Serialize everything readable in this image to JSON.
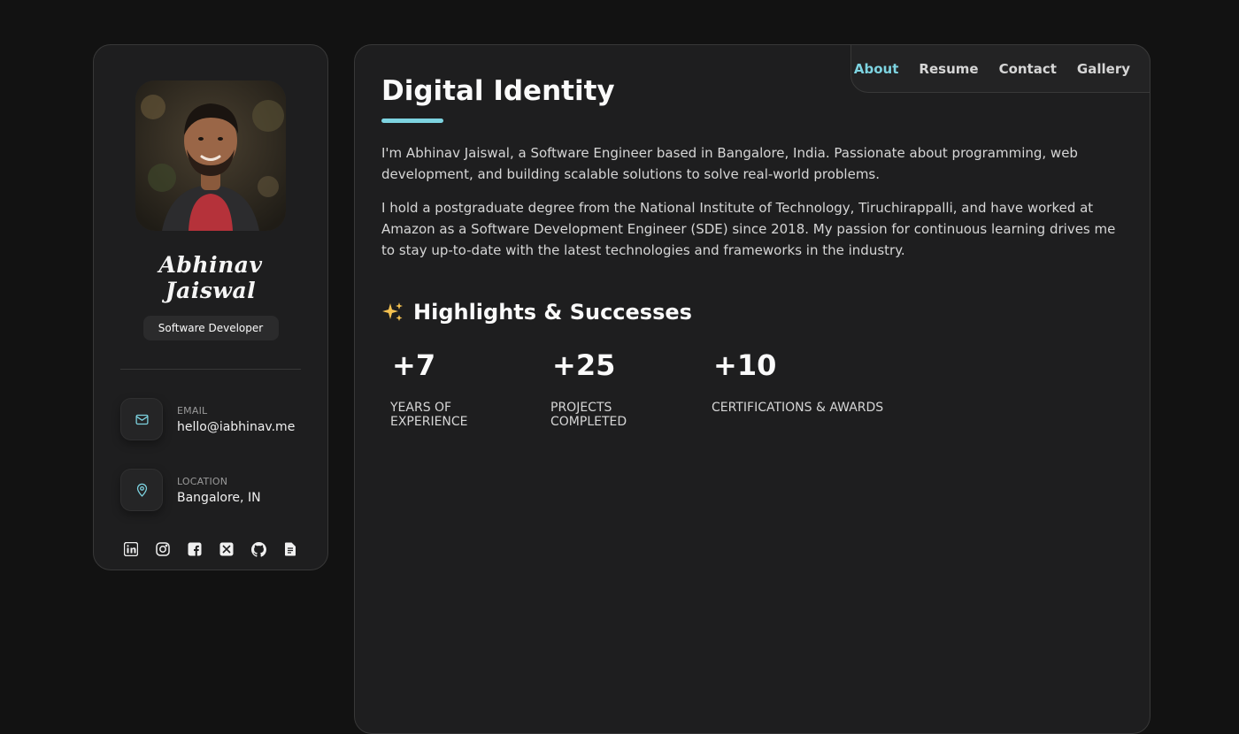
{
  "profile": {
    "name": "Abhinav Jaiswal",
    "role": "Software Developer",
    "avatar_alt": "Profile photo"
  },
  "contacts": [
    {
      "label": "EMAIL",
      "value": "hello@iabhinav.me",
      "icon": "mail-icon"
    },
    {
      "label": "LOCATION",
      "value": "Bangalore, IN",
      "icon": "map-pin-icon"
    }
  ],
  "socials": [
    {
      "name": "linkedin-icon"
    },
    {
      "name": "instagram-icon"
    },
    {
      "name": "facebook-icon"
    },
    {
      "name": "x-twitter-icon"
    },
    {
      "name": "github-icon"
    },
    {
      "name": "document-icon"
    }
  ],
  "nav": {
    "items": [
      "About",
      "Resume",
      "Contact",
      "Gallery"
    ],
    "active": "About"
  },
  "main": {
    "title": "Digital Identity",
    "paragraphs": [
      "I'm Abhinav Jaiswal, a Software Engineer based in Bangalore, India. Passionate about programming, web development, and building scalable solutions to solve real-world problems.",
      "I hold a postgraduate degree from the National Institute of Technology, Tiruchirappalli, and have worked at Amazon as a Software Development Engineer (SDE) since 2018. My passion for continuous learning drives me to stay up-to-date with the latest technologies and frameworks in the industry."
    ],
    "highlights_title": "Highlights & Successes",
    "stats": [
      {
        "value": "+7",
        "label": "YEARS OF EXPERIENCE"
      },
      {
        "value": "+25",
        "label": "PROJECTS COMPLETED"
      },
      {
        "value": "+10",
        "label": "CERTIFICATIONS & AWARDS"
      }
    ]
  },
  "colors": {
    "accent": "#7dd3e0",
    "background": "#121212",
    "card": "#1e1e1f"
  }
}
